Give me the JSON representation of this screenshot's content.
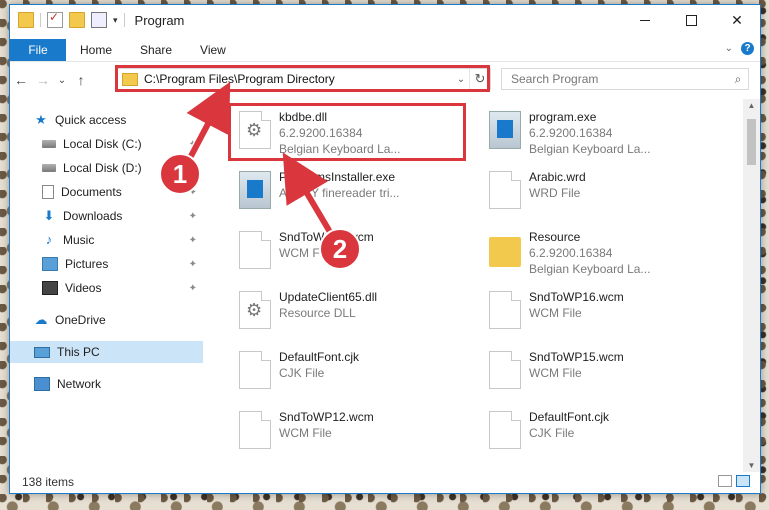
{
  "window": {
    "title": "Program",
    "controls": {
      "minimize": "",
      "maximize": "",
      "close": "✕"
    }
  },
  "ribbon": {
    "tabs": [
      "File",
      "Home",
      "Share",
      "View"
    ],
    "help": "?"
  },
  "navigation": {
    "back": "←",
    "forward": "→",
    "recent": "⌄",
    "up": "↑",
    "address_path": "C:\\Program Files\\Program Directory",
    "refresh": "↻",
    "search_placeholder": "Search Program",
    "search_icon": "⌕"
  },
  "sidebar": {
    "items": [
      {
        "label": "Quick access",
        "icon": "star-icon",
        "pinned": false
      },
      {
        "label": "Local Disk (C:)",
        "icon": "drive-icon",
        "pinned": true
      },
      {
        "label": "Local Disk (D:)",
        "icon": "drive-icon",
        "pinned": true
      },
      {
        "label": "Documents",
        "icon": "documents-icon",
        "pinned": true
      },
      {
        "label": "Downloads",
        "icon": "downloads-icon",
        "pinned": true
      },
      {
        "label": "Music",
        "icon": "music-icon",
        "pinned": true
      },
      {
        "label": "Pictures",
        "icon": "pictures-icon",
        "pinned": true
      },
      {
        "label": "Videos",
        "icon": "videos-icon",
        "pinned": true
      },
      {
        "label": "OneDrive",
        "icon": "onedrive-icon",
        "pinned": false
      },
      {
        "label": "This PC",
        "icon": "pc-icon",
        "pinned": false,
        "selected": true
      },
      {
        "label": "Network",
        "icon": "network-icon",
        "pinned": false
      }
    ],
    "pin_glyph": "📌"
  },
  "files": [
    {
      "name": "kbdbe.dll",
      "line2": "6.2.9200.16384",
      "line3": "Belgian Keyboard La...",
      "icon": "dll-gear-icon",
      "highlighted": true
    },
    {
      "name": "program.exe",
      "line2": "6.2.9200.16384",
      "line3": "Belgian Keyboard La...",
      "icon": "exe-icon"
    },
    {
      "name": "ProgramsInstaller.exe",
      "line2": "ABBYY finereader tri...",
      "line3": "",
      "icon": "exe-icon"
    },
    {
      "name": "Arabic.wrd",
      "line2": "WRD File",
      "line3": "",
      "icon": "file-icon"
    },
    {
      "name": "SndToWP18.wcm",
      "line2": "WCM File",
      "line3": "",
      "icon": "file-icon"
    },
    {
      "name": "Resource",
      "line2": "6.2.9200.16384",
      "line3": "Belgian Keyboard La...",
      "icon": "folder-icon"
    },
    {
      "name": "UpdateClient65.dll",
      "line2": "Resource DLL",
      "line3": "",
      "icon": "dll-gear-icon"
    },
    {
      "name": "SndToWP16.wcm",
      "line2": "WCM File",
      "line3": "",
      "icon": "file-icon"
    },
    {
      "name": "DefaultFont.cjk",
      "line2": "CJK File",
      "line3": "",
      "icon": "file-icon"
    },
    {
      "name": "SndToWP15.wcm",
      "line2": "WCM File",
      "line3": "",
      "icon": "file-icon"
    },
    {
      "name": "SndToWP12.wcm",
      "line2": "WCM File",
      "line3": "",
      "icon": "file-icon"
    },
    {
      "name": "DefaultFont.cjk",
      "line2": "CJK File",
      "line3": "",
      "icon": "file-icon"
    }
  ],
  "status": {
    "item_count": "138 items"
  },
  "annotations": {
    "badge1": "1",
    "badge2": "2",
    "color": "#d9363e"
  },
  "colors": {
    "accent": "#1979ca",
    "selection": "#cce4f7"
  }
}
